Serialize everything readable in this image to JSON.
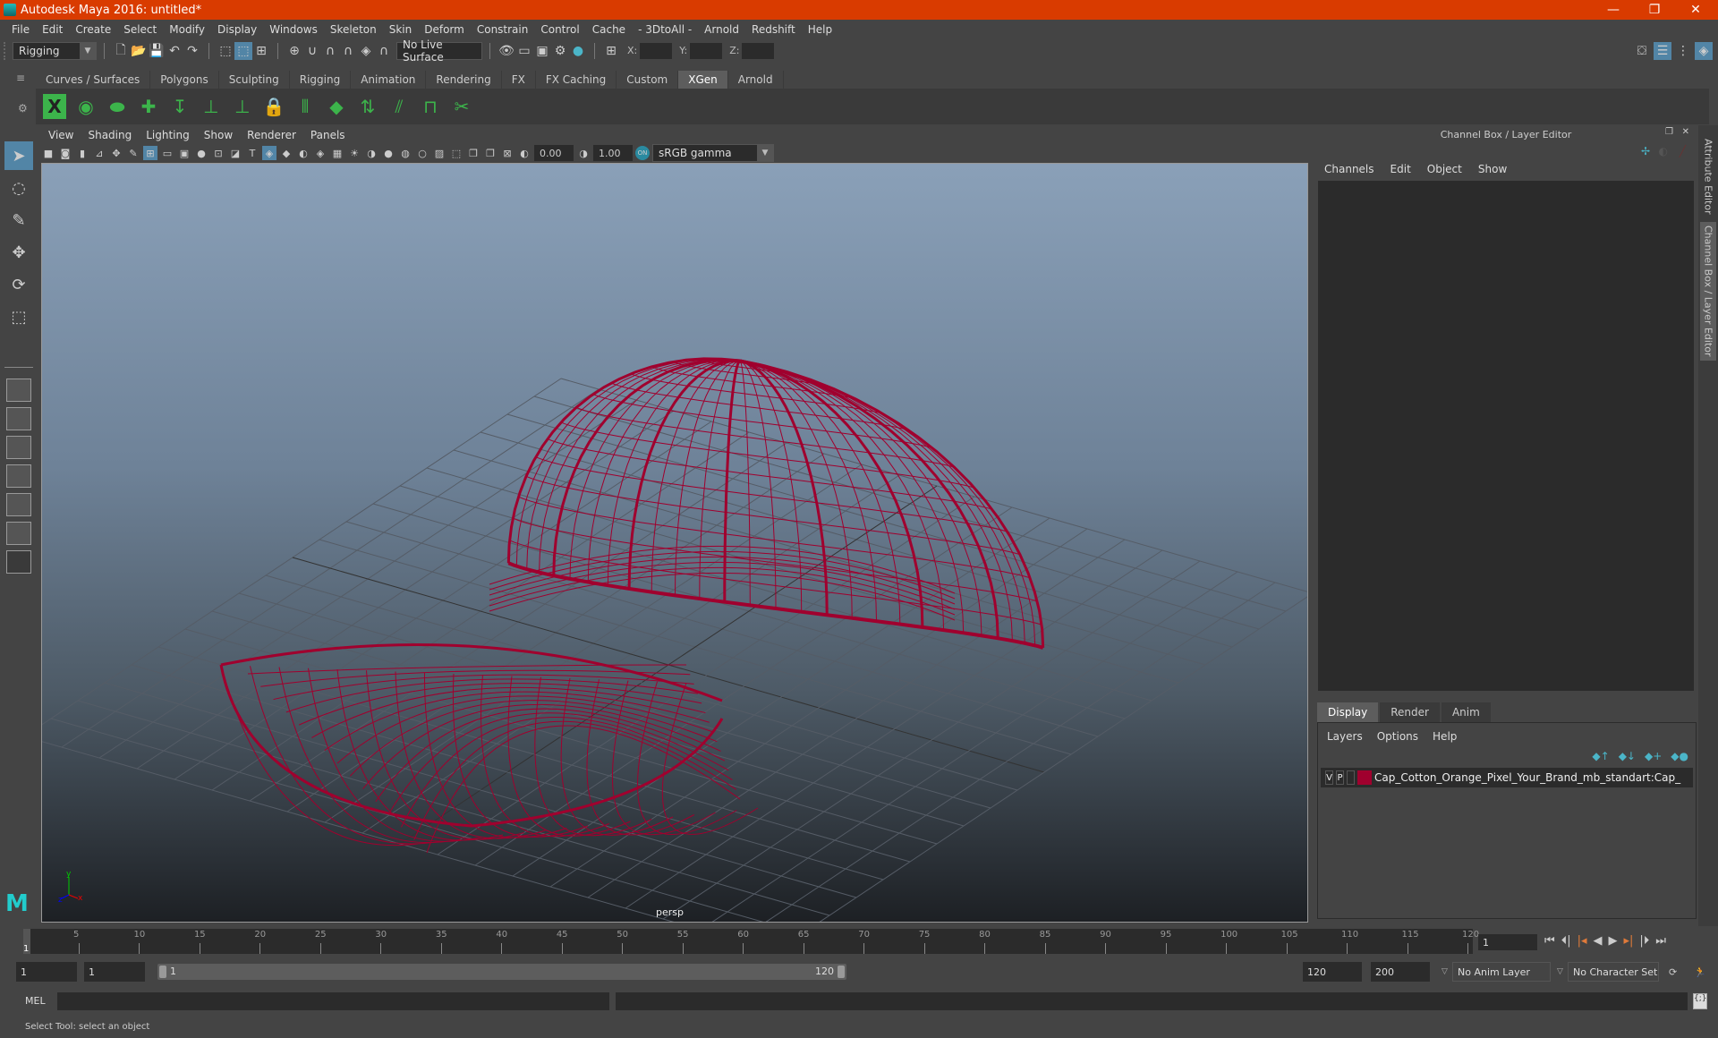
{
  "window": {
    "title": "Autodesk Maya 2016: untitled*",
    "minimize": "—",
    "restore": "❐",
    "close": "✕"
  },
  "menubar": [
    "File",
    "Edit",
    "Create",
    "Select",
    "Modify",
    "Display",
    "Windows",
    "Skeleton",
    "Skin",
    "Deform",
    "Constrain",
    "Control",
    "Cache",
    "- 3DtoAll -",
    "Arnold",
    "Redshift",
    "Help"
  ],
  "statusline": {
    "menuset": "Rigging",
    "live_surface": "No Live Surface",
    "x_label": "X:",
    "y_label": "Y:",
    "z_label": "Z:"
  },
  "shelf": {
    "tabs": [
      "Curves / Surfaces",
      "Polygons",
      "Sculpting",
      "Rigging",
      "Animation",
      "Rendering",
      "FX",
      "FX Caching",
      "Custom",
      "XGen",
      "Arnold"
    ],
    "active_tab": "XGen",
    "icons": [
      "xgen-editor-icon",
      "toggle-visibility-icon",
      "hide-description-icon",
      "add-guides-icon",
      "place-guide-icon",
      "add-guide-icon",
      "show-guide-icon",
      "lock-guide-icon",
      "guides-to-curves-icon",
      "groom-icon",
      "sculpt-guides-icon",
      "bend-guides-icon",
      "rebuild-guides-icon",
      "cut-guides-icon"
    ]
  },
  "viewport": {
    "menus": [
      "View",
      "Shading",
      "Lighting",
      "Show",
      "Renderer",
      "Panels"
    ],
    "exposure": "0.00",
    "gamma": "1.00",
    "color_space": "sRGB gamma",
    "camera_label": "persp",
    "wire_color": "#a0002e"
  },
  "channel_box": {
    "title": "Channel Box / Layer Editor",
    "menus": [
      "Channels",
      "Edit",
      "Object",
      "Show"
    ]
  },
  "layer_editor": {
    "tabs": [
      "Display",
      "Render",
      "Anim"
    ],
    "active_tab": "Display",
    "menus": [
      "Layers",
      "Options",
      "Help"
    ],
    "layers": [
      {
        "v": "V",
        "p": "P",
        "color": "#a0002e",
        "name": "Cap_Cotton_Orange_Pixel_Your_Brand_mb_standart:Cap_"
      }
    ]
  },
  "side_tabs": [
    "Attribute Editor",
    "Channel Box / Layer Editor"
  ],
  "timeline": {
    "ticks": [
      "5",
      "10",
      "15",
      "20",
      "25",
      "30",
      "35",
      "40",
      "45",
      "50",
      "55",
      "60",
      "65",
      "70",
      "75",
      "80",
      "85",
      "90",
      "95",
      "100",
      "105",
      "110",
      "115",
      "120"
    ],
    "current_frame_marker": "1",
    "current_frame": "1"
  },
  "range": {
    "start": "1",
    "anim_start": "1",
    "slider_start": "1",
    "slider_end": "120",
    "end": "120",
    "anim_end": "200",
    "anim_layer": "No Anim Layer",
    "character_set": "No Character Set"
  },
  "command_line": {
    "label": "MEL"
  },
  "help_line": "Select Tool: select an object"
}
